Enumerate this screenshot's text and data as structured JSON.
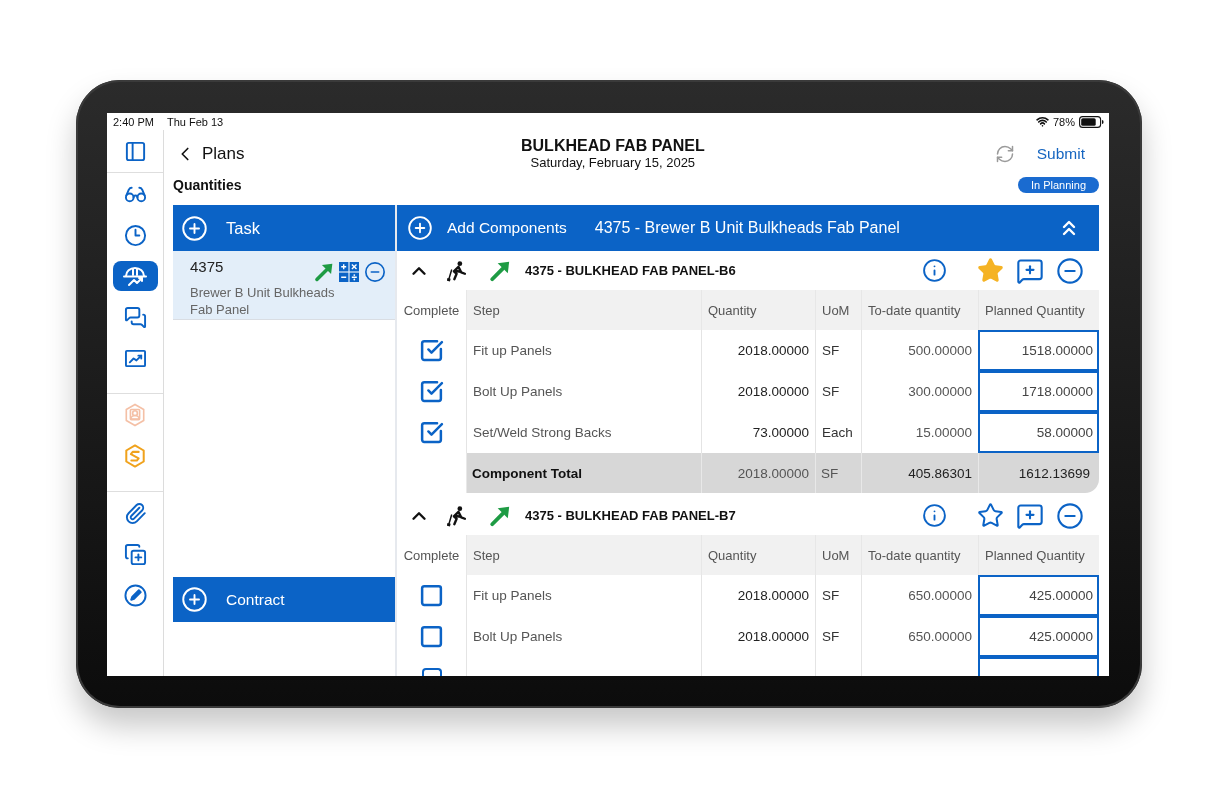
{
  "status_bar": {
    "time": "2:40 PM",
    "date": "Thu Feb 13",
    "battery": "78%"
  },
  "sidebar": {
    "groups": [
      {
        "items": [
          {
            "selected": false,
            "disabled": false
          }
        ]
      },
      {
        "items": [
          {
            "selected": false,
            "disabled": false
          },
          {
            "selected": false,
            "disabled": false
          },
          {
            "selected": true,
            "disabled": false
          },
          {
            "selected": false,
            "disabled": false
          },
          {
            "selected": false,
            "disabled": false
          }
        ]
      },
      {
        "items": [
          {
            "selected": false,
            "disabled": true
          },
          {
            "selected": false,
            "disabled": false
          }
        ]
      },
      {
        "items": [
          {
            "selected": false,
            "disabled": false
          },
          {
            "selected": false,
            "disabled": false
          },
          {
            "selected": false,
            "disabled": false
          }
        ]
      }
    ]
  },
  "header": {
    "back": "Plans",
    "title": "BULKHEAD FAB PANEL",
    "subtitle": "Saturday, February 15, 2025",
    "action": "Submit"
  },
  "section": {
    "title": "Quantities",
    "status": "In Planning"
  },
  "task_panel": {
    "header": "Task",
    "items": [
      {
        "number": "4375",
        "description": "Brewer B Unit Bulkheads Fab Panel",
        "selected": true
      }
    ],
    "footer": "Contract"
  },
  "components_panel": {
    "header": "Add Components",
    "title": "4375 - Brewer B Unit Bulkheads Fab Panel",
    "components": [
      {
        "name": "4375 - BULKHEAD FAB PANEL-B6",
        "expanded": true,
        "favorite": true,
        "columns": [
          "Complete",
          "Step",
          "Quantity",
          "UoM",
          "To-date quantity",
          "Planned Quantity"
        ],
        "rows": [
          {
            "complete": true,
            "step": "Fit up Panels",
            "quantity": "2018.00000",
            "uom": "SF",
            "to_date": "500.00000",
            "planned": "1518.00000"
          },
          {
            "complete": true,
            "step": "Bolt Up Panels",
            "quantity": "2018.00000",
            "uom": "SF",
            "to_date": "300.00000",
            "planned": "1718.00000"
          },
          {
            "complete": true,
            "step": "Set/Weld Strong Backs",
            "quantity": "73.00000",
            "uom": "Each",
            "to_date": "15.00000",
            "planned": "58.00000"
          }
        ],
        "total": {
          "label": "Component Total",
          "quantity": "2018.00000",
          "uom": "SF",
          "to_date": "405.86301",
          "planned": "1612.13699"
        }
      },
      {
        "name": "4375 - BULKHEAD FAB PANEL-B7",
        "expanded": true,
        "favorite": false,
        "columns": [
          "Complete",
          "Step",
          "Quantity",
          "UoM",
          "To-date quantity",
          "Planned Quantity"
        ],
        "rows": [
          {
            "complete": false,
            "step": "Fit up Panels",
            "quantity": "2018.00000",
            "uom": "SF",
            "to_date": "650.00000",
            "planned": "425.00000"
          },
          {
            "complete": false,
            "step": "Bolt Up Panels",
            "quantity": "2018.00000",
            "uom": "SF",
            "to_date": "650.00000",
            "planned": "425.00000"
          },
          {
            "complete": false
          }
        ]
      }
    ]
  }
}
